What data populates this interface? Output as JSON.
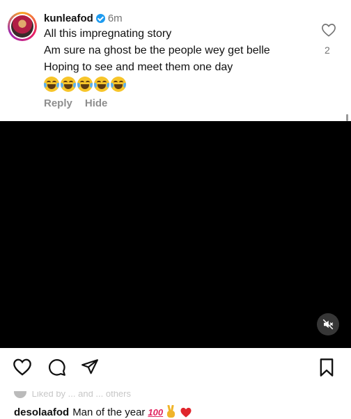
{
  "comment": {
    "username": "kunleafod",
    "time": "6m",
    "lines": [
      "All this impregnating story",
      "Am sure na ghost be the people wey get belle",
      "Hoping to see and meet them one day"
    ],
    "emojis": [
      "face-with-tears-of-joy",
      "face-with-tears-of-joy",
      "face-with-tears-of-joy",
      "face-with-tears-of-joy",
      "face-with-tears-of-joy"
    ],
    "reply_label": "Reply",
    "hide_label": "Hide",
    "like_count": "2",
    "icons": {
      "like": "heart-outline-icon",
      "verified": "verified-badge-icon"
    }
  },
  "video": {
    "background": "#000000",
    "mute_icon": "speaker-muted-icon"
  },
  "post_actions": {
    "icons": [
      "heart-outline-icon",
      "comment-bubble-icon",
      "share-paper-plane-icon",
      "bookmark-icon"
    ]
  },
  "liked_by": {
    "text": "Liked by ... and ... others"
  },
  "caption": {
    "username": "desolaafod",
    "text": "Man of the year",
    "emojis": [
      "hundred-points",
      "victory-hand",
      "red-heart"
    ]
  },
  "colors": {
    "verified": "#1d9bf0",
    "secondary_text": "#737373",
    "action_text": "#8e8e8e"
  }
}
